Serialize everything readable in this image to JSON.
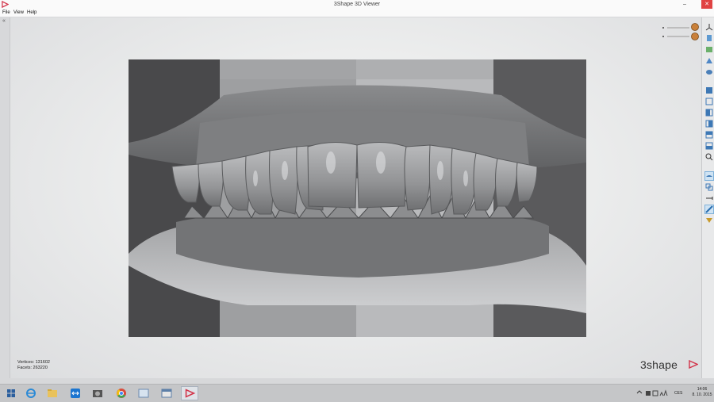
{
  "window": {
    "title": "3Shape 3D Viewer",
    "minimize": "–",
    "close": "✕"
  },
  "menu": {
    "file": "File",
    "view": "View",
    "help": "Help"
  },
  "left_panel": {
    "collapse_glyph": "«"
  },
  "stats": {
    "vertices": "Vertices: 131602",
    "facets": "Facets: 263220"
  },
  "brand": {
    "text": "3shape",
    "mark_icon": "3shape-triangle-logo",
    "accent": "#d2344a"
  },
  "toolbar_icons": [
    "axes-icon",
    "clip-icon",
    "screenshot-icon",
    "measure-icon",
    "scan-icon",
    "view-front-icon",
    "view-back-icon",
    "view-left-icon",
    "view-right-icon",
    "view-top-icon",
    "view-bottom-icon",
    "zoom-fit-icon",
    "transparency-icon",
    "bite-icon",
    "section-icon",
    "occlusion-icon",
    "layer-icon"
  ],
  "taskbar": {
    "apps": [
      "start-icon",
      "ie-icon",
      "explorer-icon",
      "teamviewer-icon",
      "camera-icon",
      "chrome-icon",
      "viewer-icon",
      "app-icon",
      "3shape-icon"
    ],
    "language": "CES",
    "time": "14:06",
    "date": "8. 10. 2015"
  },
  "colors": {
    "viewport": "#ececed",
    "backdrop_dark": "#4a4a4c",
    "backdrop_light": "#b5b6b8",
    "model": "#9a9b9d"
  }
}
